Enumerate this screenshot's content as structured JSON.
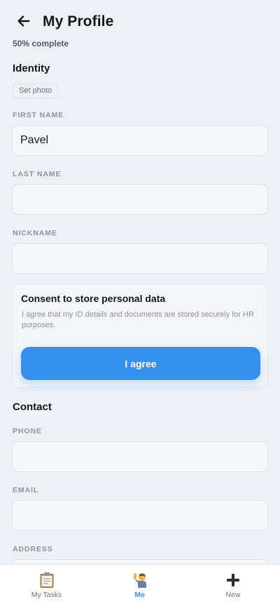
{
  "header": {
    "title": "My Profile",
    "progress": "50% complete"
  },
  "identity": {
    "section_title": "Identity",
    "set_photo_label": "Set photo",
    "first_name_label": "FIRST NAME",
    "first_name_value": "Pavel",
    "last_name_label": "LAST NAME",
    "last_name_value": "",
    "nickname_label": "NICKNAME",
    "nickname_value": ""
  },
  "consent": {
    "title": "Consent to store personal data",
    "text": "I agree that my ID details and documents are stored securely for HR purposes.",
    "button_label": "I agree"
  },
  "contact": {
    "section_title": "Contact",
    "phone_label": "PHONE",
    "phone_value": "",
    "email_label": "EMAIL",
    "email_value": "",
    "address_label": "ADDRESS",
    "address_value": ""
  },
  "tabbar": {
    "tabs": [
      {
        "label": "My Tasks",
        "icon": "clipboard-icon"
      },
      {
        "label": "Me",
        "icon": "person-raising-hand-icon"
      },
      {
        "label": "New",
        "icon": "plus-icon"
      }
    ],
    "active_tab": "Me"
  },
  "colors": {
    "accent": "#3691ee",
    "background": "#edf0f5",
    "field_background": "#f5f7fa",
    "text_primary": "#14161c",
    "text_muted": "#8d929d"
  }
}
